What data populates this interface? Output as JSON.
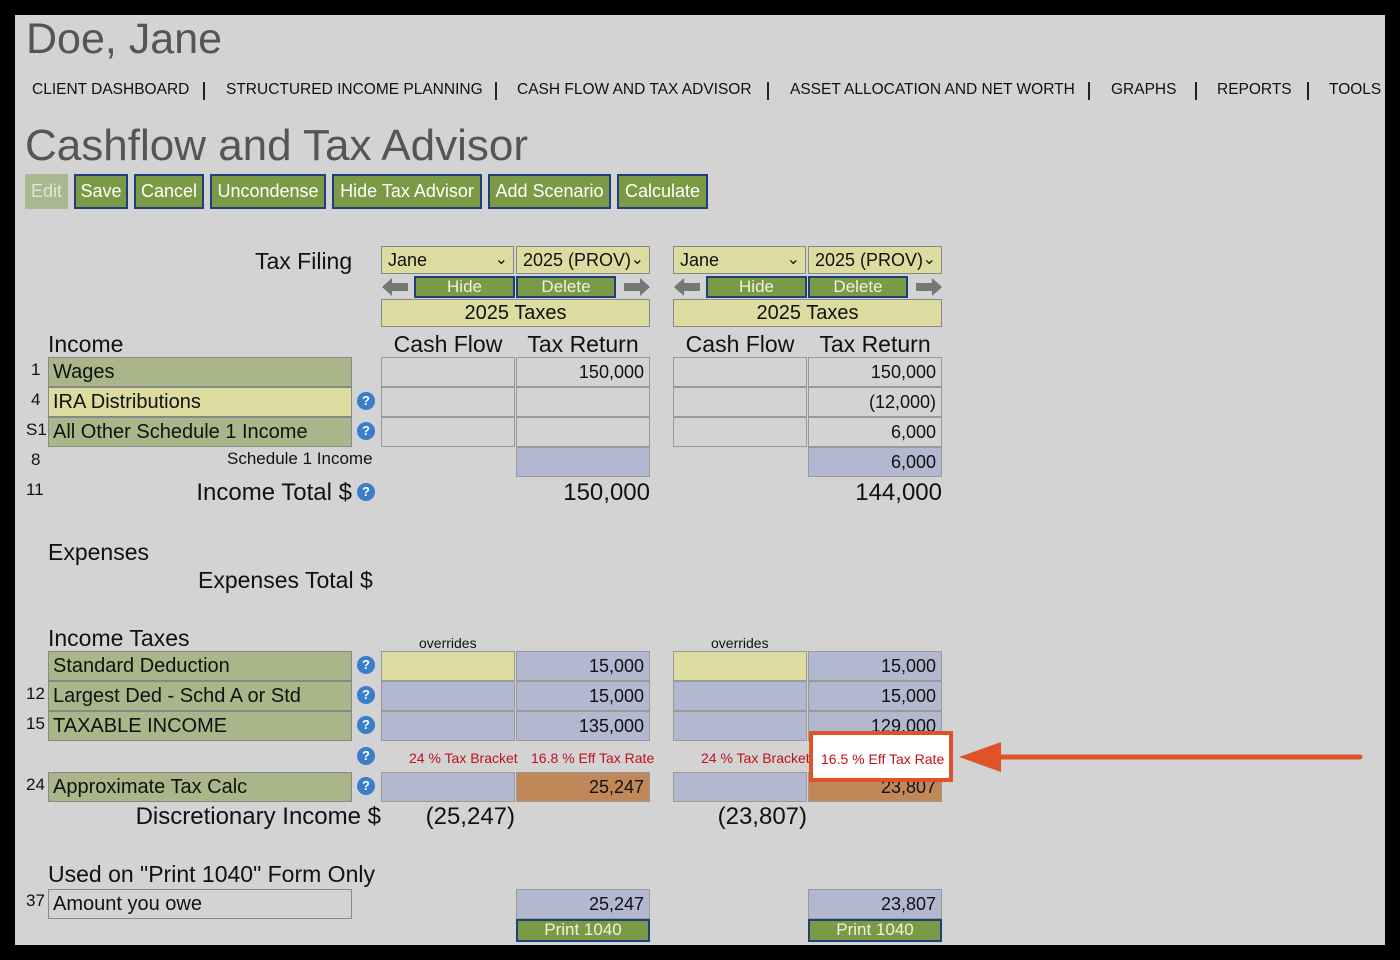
{
  "client_name": "Doe, Jane",
  "nav": [
    "CLIENT DASHBOARD",
    "STRUCTURED INCOME PLANNING",
    "CASH FLOW AND TAX ADVISOR",
    "ASSET ALLOCATION AND NET WORTH",
    "GRAPHS",
    "REPORTS",
    "TOOLS"
  ],
  "page_title": "Cashflow and Tax Advisor",
  "toolbar": [
    "Edit",
    "Save",
    "Cancel",
    "Uncondense",
    "Hide Tax Advisor",
    "Add Scenario",
    "Calculate"
  ],
  "tax_filing_label": "Tax Filing",
  "scenarios": [
    {
      "person": "Jane",
      "year": "2025 (PROV)",
      "hide": "Hide",
      "delete": "Delete",
      "header": "2025 Taxes",
      "col_cf": "Cash Flow",
      "col_tr": "Tax Return",
      "wages": "150,000",
      "ira": "",
      "other": "",
      "sched1": "",
      "income_total": "150,000",
      "overrides": "overrides",
      "std_ded": "15,000",
      "largest_ded": "15,000",
      "taxable": "135,000",
      "bracket": "24 % Tax Bracket",
      "eff_rate": "16.8 % Eff Tax Rate",
      "approx_tax": "25,247",
      "disc_income": "(25,247)",
      "amount_owe": "25,247",
      "print": "Print 1040"
    },
    {
      "person": "Jane",
      "year": "2025 (PROV)",
      "hide": "Hide",
      "delete": "Delete",
      "header": "2025 Taxes",
      "col_cf": "Cash Flow",
      "col_tr": "Tax Return",
      "wages": "150,000",
      "ira": "(12,000)",
      "other": "6,000",
      "sched1": "6,000",
      "income_total": "144,000",
      "overrides": "overrides",
      "std_ded": "15,000",
      "largest_ded": "15,000",
      "taxable": "129,000",
      "bracket": "24 % Tax Bracket",
      "eff_rate": "16.5 % Eff Tax Rate",
      "approx_tax": "23,807",
      "disc_income": "(23,807)",
      "amount_owe": "23,807",
      "print": "Print 1040"
    }
  ],
  "sections": {
    "income": "Income",
    "expenses": "Expenses",
    "expenses_total": "Expenses Total $",
    "income_taxes": "Income Taxes",
    "print_only": "Used on \"Print 1040\" Form Only"
  },
  "rows": {
    "wages": {
      "num": "1",
      "label": "Wages"
    },
    "ira": {
      "num": "4",
      "label": "IRA Distributions"
    },
    "other": {
      "num": "S1",
      "label": "All Other Schedule 1 Income"
    },
    "sched1": {
      "num": "8",
      "label": "Schedule 1 Income"
    },
    "income_total": {
      "num": "11",
      "label": "Income Total $"
    },
    "std_ded": {
      "num": "",
      "label": "Standard Deduction"
    },
    "largest_ded": {
      "num": "12",
      "label": "Largest Ded - Schd A or Std"
    },
    "taxable": {
      "num": "15",
      "label": "TAXABLE INCOME"
    },
    "approx_tax": {
      "num": "24",
      "label": "Approximate Tax Calc"
    },
    "disc_income": {
      "label": "Discretionary Income $"
    },
    "amount_owe": {
      "num": "37",
      "label": "Amount you owe"
    }
  },
  "colors": {
    "highlight": "#e0522a",
    "accent_green": "#7b9a45",
    "blue_cell": "#b1b8d0",
    "tax_cell": "#c08858"
  },
  "icons": [
    "help-icon",
    "left-arrow-icon",
    "right-arrow-icon",
    "chevron-down-icon"
  ]
}
